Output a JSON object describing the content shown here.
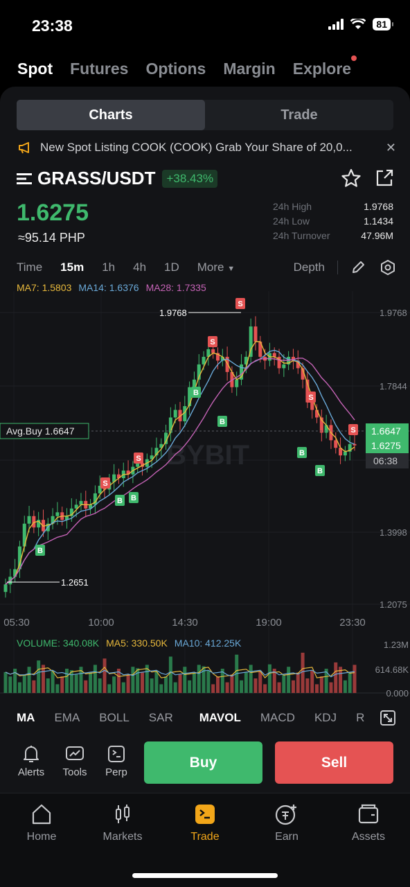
{
  "status": {
    "time": "23:38",
    "battery": "81"
  },
  "top_tabs": [
    "Spot",
    "Futures",
    "Options",
    "Margin",
    "Explore"
  ],
  "segment": {
    "charts": "Charts",
    "trade": "Trade"
  },
  "notice": "New Spot Listing  COOK (COOK)  Grab Your Share of 20,0...",
  "pair": {
    "name": "GRASS/USDT",
    "change": "+38.43%"
  },
  "price": {
    "last": "1.6275",
    "fiat": "≈95.14 PHP"
  },
  "stats": [
    {
      "label": "24h High",
      "value": "1.9768"
    },
    {
      "label": "24h Low",
      "value": "1.1434"
    },
    {
      "label": "24h Turnover",
      "value": "47.96M"
    }
  ],
  "timeframes": [
    "Time",
    "15m",
    "1h",
    "4h",
    "1D",
    "More"
  ],
  "depth": "Depth",
  "ma_legend": [
    {
      "text": "MA7: 1.5803",
      "color": "#e8b93c"
    },
    {
      "text": "MA14: 1.6376",
      "color": "#6aa9d8"
    },
    {
      "text": "MA28: 1.7335",
      "color": "#c563b6"
    }
  ],
  "vol_legend": [
    {
      "text": "VOLUME: 340.08K",
      "color": "#3fb96d"
    },
    {
      "text": "MA5: 330.50K",
      "color": "#e8b93c"
    },
    {
      "text": "MA10: 412.25K",
      "color": "#6aa9d8"
    }
  ],
  "chart_data": {
    "type": "candlestick",
    "y_ticks": [
      "1.9768",
      "1.7844",
      "1.3998",
      "1.2075"
    ],
    "x_ticks": [
      "05:30",
      "10:00",
      "14:30",
      "19:00",
      "23:30"
    ],
    "high_label": "1.9768",
    "low_label": "1.2651",
    "avg_buy": "Avg.Buy 1.6647",
    "price_tags": [
      "1.6647",
      "1.6275",
      "06:38"
    ],
    "vol_ticks": [
      "1.23M",
      "614.68K",
      "0.000"
    ],
    "watermark": "BYBIT",
    "markers": {
      "buy": "B",
      "sell": "S"
    },
    "close_series": [
      1.26,
      1.28,
      1.3,
      1.36,
      1.42,
      1.44,
      1.41,
      1.43,
      1.4,
      1.42,
      1.44,
      1.45,
      1.43,
      1.44,
      1.46,
      1.47,
      1.48,
      1.46,
      1.47,
      1.5,
      1.52,
      1.51,
      1.53,
      1.55,
      1.54,
      1.56,
      1.55,
      1.57,
      1.58,
      1.57,
      1.59,
      1.6,
      1.62,
      1.63,
      1.66,
      1.7,
      1.72,
      1.69,
      1.73,
      1.78,
      1.8,
      1.84,
      1.86,
      1.88,
      1.87,
      1.85,
      1.86,
      1.82,
      1.78,
      1.8,
      1.84,
      1.86,
      1.94,
      1.9,
      1.86,
      1.85,
      1.87,
      1.86,
      1.83,
      1.84,
      1.86,
      1.85,
      1.83,
      1.8,
      1.74,
      1.72,
      1.7,
      1.66,
      1.68,
      1.64,
      1.62,
      1.6,
      1.61,
      1.63,
      1.6275
    ]
  },
  "indicators": [
    "MA",
    "EMA",
    "BOLL",
    "SAR",
    "MAVOL",
    "MACD",
    "KDJ",
    "R"
  ],
  "tools": [
    "Alerts",
    "Tools",
    "Perp"
  ],
  "buttons": {
    "buy": "Buy",
    "sell": "Sell"
  },
  "nav": [
    "Home",
    "Markets",
    "Trade",
    "Earn",
    "Assets"
  ],
  "colors": {
    "up": "#3fb96d",
    "down": "#e55353",
    "accent": "#f2a619"
  }
}
